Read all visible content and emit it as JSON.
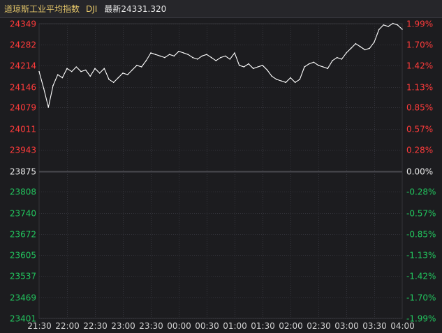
{
  "header": {
    "index_name": "道琼斯工业平均指数",
    "code": "DJI",
    "latest_label": "最新",
    "latest_value": "24331.320"
  },
  "colors": {
    "background": "#1c1c1f",
    "grid": "#33333a",
    "baseline": "#4a4a50",
    "line": "#ffffff",
    "up": "#ff3b3b",
    "down": "#22c55e",
    "neutral": "#e8e8e8",
    "axis_text": "#d0d0d0"
  },
  "chart_data": {
    "type": "line",
    "title": "道琼斯工业平均指数",
    "xlabel": "",
    "ylabel": "",
    "grid": true,
    "base_value": 23875,
    "ylim": [
      23401,
      24349
    ],
    "y_ticks": [
      24349,
      24282,
      24214,
      24146,
      24079,
      24011,
      23943,
      23875,
      23808,
      23740,
      23672,
      23605,
      23537,
      23469,
      23401
    ],
    "pct_ticks": [
      "1.99%",
      "1.70%",
      "1.42%",
      "1.13%",
      "0.85%",
      "0.57%",
      "0.28%",
      "0.00%",
      "-0.28%",
      "-0.57%",
      "-0.85%",
      "-1.13%",
      "-1.42%",
      "-1.70%",
      "-1.99%"
    ],
    "x_ticks": [
      "21:30",
      "22:00",
      "22:30",
      "23:00",
      "23:30",
      "00:00",
      "00:30",
      "01:00",
      "01:30",
      "02:00",
      "02:30",
      "03:00",
      "03:30",
      "04:00"
    ],
    "series": [
      {
        "x": [
          "21:30",
          "21:35",
          "21:40",
          "21:45",
          "21:50",
          "21:55",
          "22:00",
          "22:05",
          "22:10",
          "22:15",
          "22:20",
          "22:25",
          "22:30",
          "22:35",
          "22:40",
          "22:45",
          "22:50",
          "22:55",
          "23:00",
          "23:05",
          "23:10",
          "23:15",
          "23:20",
          "23:25",
          "23:30",
          "23:35",
          "23:40",
          "23:45",
          "23:50",
          "23:55",
          "00:00",
          "00:05",
          "00:10",
          "00:15",
          "00:20",
          "00:25",
          "00:30",
          "00:35",
          "00:40",
          "00:45",
          "00:50",
          "00:55",
          "01:00",
          "01:05",
          "01:10",
          "01:15",
          "01:20",
          "01:25",
          "01:30",
          "01:35",
          "01:40",
          "01:45",
          "01:50",
          "01:55",
          "02:00",
          "02:05",
          "02:10",
          "02:15",
          "02:20",
          "02:25",
          "02:30",
          "02:35",
          "02:40",
          "02:45",
          "02:50",
          "02:55",
          "03:00",
          "03:05",
          "03:10",
          "03:15",
          "03:20",
          "03:25",
          "03:30",
          "03:35",
          "03:40",
          "03:45",
          "03:50",
          "03:55",
          "04:00"
        ],
        "values": [
          24195,
          24140,
          24080,
          24150,
          24185,
          24175,
          24205,
          24195,
          24210,
          24195,
          24200,
          24180,
          24205,
          24190,
          24205,
          24170,
          24160,
          24175,
          24190,
          24185,
          24200,
          24215,
          24210,
          24230,
          24255,
          24250,
          24245,
          24240,
          24250,
          24245,
          24260,
          24255,
          24250,
          24240,
          24235,
          24245,
          24250,
          24240,
          24230,
          24240,
          24245,
          24235,
          24255,
          24215,
          24210,
          24220,
          24205,
          24210,
          24215,
          24200,
          24180,
          24170,
          24165,
          24160,
          24175,
          24160,
          24170,
          24210,
          24220,
          24225,
          24215,
          24210,
          24205,
          24230,
          24240,
          24235,
          24255,
          24270,
          24285,
          24275,
          24265,
          24270,
          24290,
          24330,
          24345,
          24340,
          24350,
          24345,
          24331
        ]
      }
    ]
  }
}
